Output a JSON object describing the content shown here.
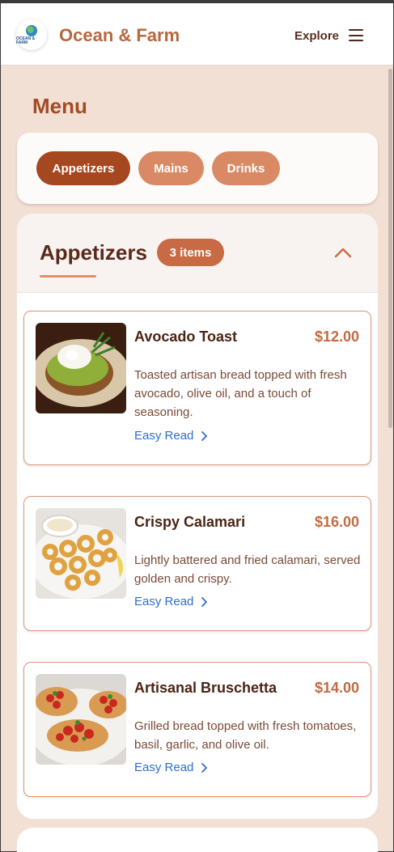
{
  "header": {
    "logo_text": "OCEAN & FARM",
    "brand": "Ocean & Farm",
    "explore_label": "Explore"
  },
  "menu": {
    "title": "Menu",
    "tabs": [
      {
        "label": "Appetizers",
        "active": true
      },
      {
        "label": "Mains",
        "active": false
      },
      {
        "label": "Drinks",
        "active": false
      }
    ]
  },
  "section": {
    "title": "Appetizers",
    "count_label": "3 items",
    "items": [
      {
        "name": "Avocado Toast",
        "price": "$12.00",
        "description": "Toasted artisan bread topped with fresh avocado, olive oil, and a touch of seasoning.",
        "easy_read": "Easy Read"
      },
      {
        "name": "Crispy Calamari",
        "price": "$16.00",
        "description": "Lightly battered and fried calamari, served golden and crispy.",
        "easy_read": "Easy Read"
      },
      {
        "name": "Artisanal Bruschetta",
        "price": "$14.00",
        "description": "Grilled bread topped with fresh tomatoes, basil, garlic, and olive oil.",
        "easy_read": "Easy Read"
      }
    ]
  },
  "colors": {
    "brand": "#b8673e",
    "accent": "#a5471f",
    "tab_inactive": "#d98a65",
    "link": "#2f6ed0",
    "background": "#f2e0d5"
  }
}
